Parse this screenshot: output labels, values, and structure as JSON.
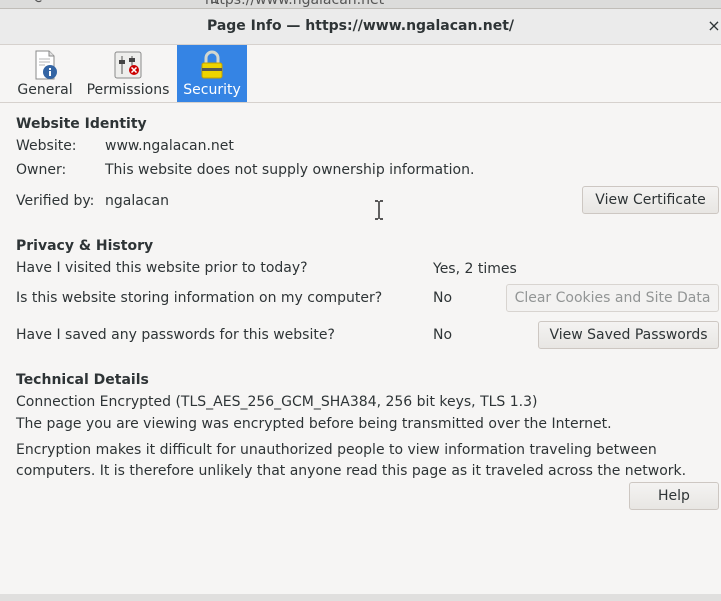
{
  "browser": {
    "url_fragment": "https://www.ngalacan.net"
  },
  "dialog": {
    "title": "Page Info — https://www.ngalacan.net/",
    "close_glyph": "×"
  },
  "tabs": [
    {
      "label": "General",
      "icon": "info-document-icon",
      "active": false
    },
    {
      "label": "Permissions",
      "icon": "permissions-sliders-icon",
      "active": false
    },
    {
      "label": "Security",
      "icon": "padlock-icon",
      "active": true
    }
  ],
  "identity": {
    "heading": "Website Identity",
    "website_label": "Website:",
    "website_value": "www.ngalacan.net",
    "owner_label": "Owner:",
    "owner_value": "This website does not supply ownership information.",
    "verified_label": "Verified by:",
    "verified_value": "ngalacan",
    "view_certificate": "View Certificate"
  },
  "privacy": {
    "heading": "Privacy & History",
    "visited_question": "Have I visited this website prior to today?",
    "visited_answer": "Yes, 2 times",
    "storing_question": "Is this website storing information on my computer?",
    "storing_answer": "No",
    "clear_cookies": "Clear Cookies and Site Data",
    "passwords_question": "Have I saved any passwords for this website?",
    "passwords_answer": "No",
    "view_passwords": "View Saved Passwords"
  },
  "technical": {
    "heading": "Technical Details",
    "connection": "Connection Encrypted (TLS_AES_256_GCM_SHA384, 256 bit keys, TLS 1.3)",
    "line1": "The page you are viewing was encrypted before being transmitted over the Internet.",
    "line2": "Encryption makes it difficult for unauthorized people to view information traveling between computers. It is therefore unlikely that anyone read this page as it traveled across the network."
  },
  "help": "Help",
  "colors": {
    "accent": "#3584e4",
    "background": "#f6f5f4",
    "text": "#2e3436"
  }
}
